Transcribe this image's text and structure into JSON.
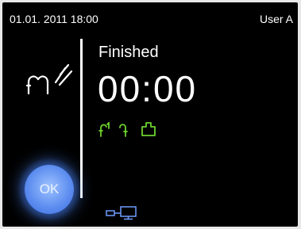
{
  "statusbar": {
    "datetime": "01.01. 2011 18:00",
    "user": "User A"
  },
  "program": {
    "status": "Finished",
    "timer": "00:00",
    "icon": "shower-nozzle-spray-icon",
    "phase_icons": [
      "rinse-spray-icon",
      "rinse-icon",
      "end-drying-icon"
    ]
  },
  "ok_button": {
    "label": "OK"
  },
  "footer": {
    "icon": "network-connection-icon"
  },
  "colors": {
    "background": "#000000",
    "text": "#ffffff",
    "phase_icons": "#6dd22e",
    "ok_button": "#5f8ff0",
    "network_icon": "#6f9dff"
  }
}
